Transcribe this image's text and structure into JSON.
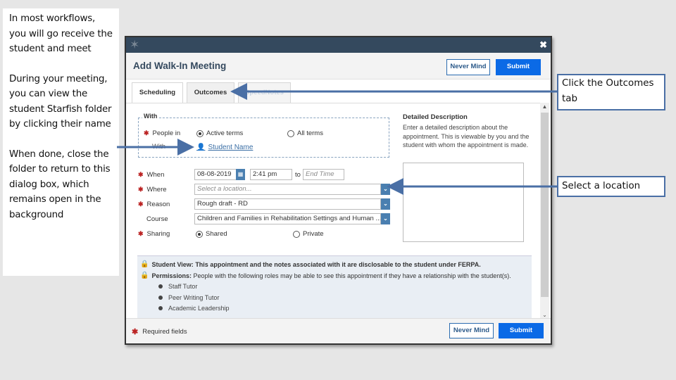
{
  "notes": [
    "In most workflows, you will go receive the student and meet",
    "During your meeting, you can view the student Starfish folder by clicking their name",
    "When done, close the folder to return to this dialog box, which remains open in the background"
  ],
  "callouts": {
    "outcomes": "Click the Outcomes tab",
    "location": "Select a location"
  },
  "dialog": {
    "title": "Add Walk-In Meeting",
    "logo_icon": "starfish-icon",
    "close_glyph": "✖",
    "header_buttons": {
      "never_mind": "Never Mind",
      "submit": "Submit"
    },
    "tabs": [
      {
        "label": "Scheduling",
        "active": true
      },
      {
        "label": "Outcomes",
        "active": false
      },
      {
        "label": "SpeedNotes",
        "active": false
      }
    ],
    "form": {
      "with_legend": "With",
      "people_in_label": "People in",
      "with_label": "With",
      "terms_options": [
        {
          "label": "Active terms",
          "selected": true
        },
        {
          "label": "All terms",
          "selected": false
        }
      ],
      "student_name": "Student Name",
      "when_label": "When",
      "date_value": "08-08-2019",
      "start_time": "2:41 pm",
      "to_label": "to",
      "end_time_placeholder": "End Time",
      "where_label": "Where",
      "where_placeholder": "Select a location...",
      "reason_label": "Reason",
      "reason_value": "Rough draft - RD",
      "course_label": "Course",
      "course_value": "Children and Families in Rehabilitation Settings and Human ...",
      "sharing_label": "Sharing",
      "sharing_options": [
        {
          "label": "Shared",
          "selected": true
        },
        {
          "label": "Private",
          "selected": false
        }
      ],
      "required_marker": "✱"
    },
    "description": {
      "title": "Detailed Description",
      "help": "Enter a detailed description about the appointment. This is viewable by you and the student with whom the appointment is made.",
      "value": ""
    },
    "permissions": {
      "student_view_label": "Student View:",
      "student_view_text": "This appointment and the notes associated with it are disclosable to the student under FERPA.",
      "permissions_label": "Permissions:",
      "permissions_text": "People with the following roles may be able to see this appointment if they have a relationship with the student(s).",
      "roles": [
        "Staff Tutor",
        "Peer Writing Tutor",
        "Academic Leadership"
      ]
    },
    "footer": {
      "required_note": "Required fields",
      "never_mind": "Never Mind",
      "submit": "Submit"
    }
  },
  "colors": {
    "titlebar": "#34495e",
    "primary": "#0b6ae6",
    "callout_border": "#4a6fa5",
    "required": "#b22222"
  }
}
